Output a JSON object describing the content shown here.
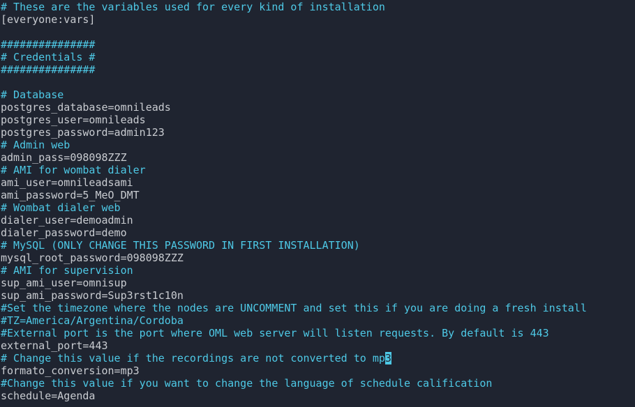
{
  "terminal": {
    "background": "#1f2430",
    "comment_color": "#4ec9e6",
    "text_color": "#c9ccd1",
    "lines": [
      {
        "kind": "comment",
        "text": "# These are the variables used for every kind of installation"
      },
      {
        "kind": "code",
        "text": "[everyone:vars]"
      },
      {
        "kind": "blank",
        "text": ""
      },
      {
        "kind": "comment",
        "text": "###############"
      },
      {
        "kind": "comment",
        "text": "# Credentials #"
      },
      {
        "kind": "comment",
        "text": "###############"
      },
      {
        "kind": "blank",
        "text": ""
      },
      {
        "kind": "comment",
        "text": "# Database"
      },
      {
        "kind": "code",
        "text": "postgres_database=omnileads"
      },
      {
        "kind": "code",
        "text": "postgres_user=omnileads"
      },
      {
        "kind": "code",
        "text": "postgres_password=admin123"
      },
      {
        "kind": "comment",
        "text": "# Admin web"
      },
      {
        "kind": "code",
        "text": "admin_pass=098098ZZZ"
      },
      {
        "kind": "comment",
        "text": "# AMI for wombat dialer"
      },
      {
        "kind": "code",
        "text": "ami_user=omnileadsami"
      },
      {
        "kind": "code",
        "text": "ami_password=5_MeO_DMT"
      },
      {
        "kind": "comment",
        "text": "# Wombat dialer web"
      },
      {
        "kind": "code",
        "text": "dialer_user=demoadmin"
      },
      {
        "kind": "code",
        "text": "dialer_password=demo"
      },
      {
        "kind": "comment",
        "text": "# MySQL (ONLY CHANGE THIS PASSWORD IN FIRST INSTALLATION)"
      },
      {
        "kind": "code",
        "text": "mysql_root_password=098098ZZZ"
      },
      {
        "kind": "comment",
        "text": "# AMI for supervision"
      },
      {
        "kind": "code",
        "text": "sup_ami_user=omnisup"
      },
      {
        "kind": "code",
        "text": "sup_ami_password=Sup3rst1c10n"
      },
      {
        "kind": "comment",
        "text": "#Set the timezone where the nodes are UNCOMMENT and set this if you are doing a fresh install"
      },
      {
        "kind": "comment",
        "text": "#TZ=America/Argentina/Cordoba"
      },
      {
        "kind": "comment",
        "text": "#External port is the port where OML web server will listen requests. By default is 443"
      },
      {
        "kind": "code",
        "text": "external_port=443"
      },
      {
        "kind": "comment-cursor",
        "text": "# Change this value if the recordings are not converted to mp",
        "cursor": "3"
      },
      {
        "kind": "code",
        "text": "formato_conversion=mp3"
      },
      {
        "kind": "comment",
        "text": "#Change this value if you want to change the language of schedule calification"
      },
      {
        "kind": "code",
        "text": "schedule=Agenda"
      }
    ]
  }
}
